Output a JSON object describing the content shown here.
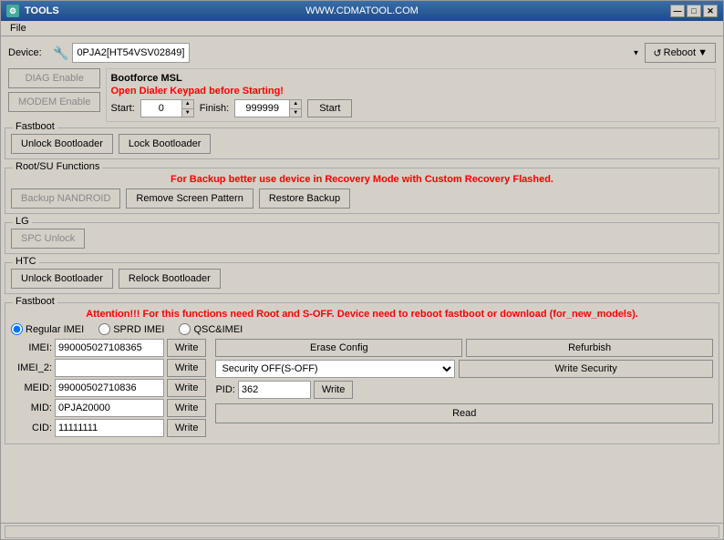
{
  "window": {
    "title": "TOOLS",
    "subtitle": "WWW.CDMATOOL.COM",
    "icon": "⚙"
  },
  "titlebar": {
    "minimize": "—",
    "maximize": "□",
    "close": "✕"
  },
  "menu": {
    "file_label": "File"
  },
  "device": {
    "label": "Device:",
    "icon": "🔧",
    "value": "0PJA2[HT54VSV02849]",
    "reboot_label": "Reboot",
    "reboot_arrow": "▼"
  },
  "buttons": {
    "diag_enable": "DIAG Enable",
    "modem_enable": "MODEM Enable"
  },
  "bootforce": {
    "title": "Bootforce MSL",
    "warning": "Open Dialer Keypad before Starting!",
    "start_label": "Start:",
    "start_value": "0",
    "finish_label": "Finish:",
    "finish_value": "999999",
    "start_btn": "Start"
  },
  "fastboot1": {
    "group_label": "Fastboot",
    "unlock_bootloader": "Unlock Bootloader",
    "lock_bootloader": "Lock Bootloader"
  },
  "rootsu": {
    "group_label": "Root/SU Functions",
    "warning": "For Backup better use device in Recovery Mode with Custom Recovery Flashed.",
    "backup_nandroid": "Backup NANDROID",
    "remove_screen_pattern": "Remove Screen Pattern",
    "restore_backup": "Restore Backup"
  },
  "lg": {
    "group_label": "LG",
    "spc_unlock": "SPC Unlock"
  },
  "htc": {
    "group_label": "HTC",
    "unlock_bootloader": "Unlock Bootloader",
    "relock_bootloader": "Relock Bootloader"
  },
  "fastboot2": {
    "group_label": "Fastboot",
    "attention": "Attention!!! For this functions need Root and S-OFF. Device need to reboot fastboot or download (for_new_models).",
    "radio_regular": "Regular IMEI",
    "radio_sprd": "SPRD IMEI",
    "radio_qsc": "QSC&IMEI",
    "fields": [
      {
        "label": "IMEI:",
        "value": "99000502710836 5",
        "id": "imei"
      },
      {
        "label": "IMEI_2:",
        "value": "",
        "id": "imei2"
      },
      {
        "label": "MEID:",
        "value": "99000502710836",
        "id": "meid"
      },
      {
        "label": "MID:",
        "value": "0PJA20000",
        "id": "mid"
      },
      {
        "label": "CID:",
        "value": "11111111",
        "id": "cid"
      }
    ],
    "write_label": "Write",
    "erase_config": "Erase Config",
    "refurbish": "Refurbish",
    "security_off": "Security OFF(S-OFF)",
    "write_security": "Write Security",
    "pid_label": "PID:",
    "pid_value": "362",
    "pid_write": "Write",
    "read_btn": "Read"
  },
  "statusbar": {
    "text": ""
  }
}
